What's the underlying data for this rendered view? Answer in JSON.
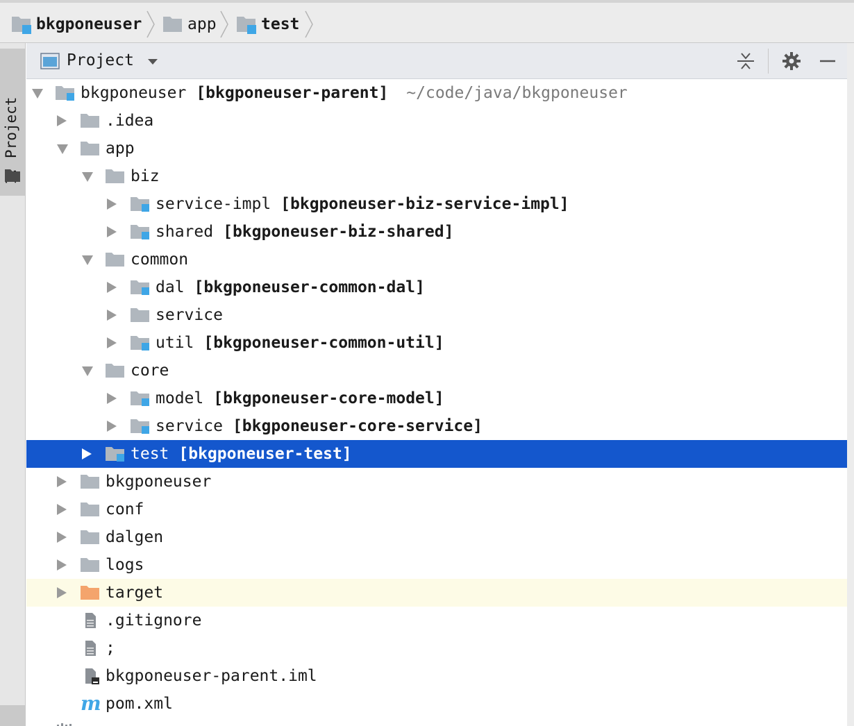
{
  "breadcrumb": {
    "items": [
      {
        "label": "bkgponeuser",
        "bold": true
      },
      {
        "label": "app",
        "bold": false
      },
      {
        "label": "test",
        "bold": true
      }
    ]
  },
  "sidebar": {
    "tab_label": "1: Project"
  },
  "toolbar": {
    "title": "Project"
  },
  "tree": {
    "rows": [
      {
        "label": "bkgponeuser",
        "module": "[bkgponeuser-parent]",
        "path": "~/code/java/bkgponeuser"
      },
      {
        "label": ".idea"
      },
      {
        "label": "app"
      },
      {
        "label": "biz"
      },
      {
        "label": "service-impl",
        "module": "[bkgponeuser-biz-service-impl]"
      },
      {
        "label": "shared",
        "module": "[bkgponeuser-biz-shared]"
      },
      {
        "label": "common"
      },
      {
        "label": "dal",
        "module": "[bkgponeuser-common-dal]"
      },
      {
        "label": "service"
      },
      {
        "label": "util",
        "module": "[bkgponeuser-common-util]"
      },
      {
        "label": "core"
      },
      {
        "label": "model",
        "module": "[bkgponeuser-core-model]"
      },
      {
        "label": "service",
        "module": "[bkgponeuser-core-service]"
      },
      {
        "label": "test",
        "module": "[bkgponeuser-test]"
      },
      {
        "label": "bkgponeuser"
      },
      {
        "label": "conf"
      },
      {
        "label": "dalgen"
      },
      {
        "label": "logs"
      },
      {
        "label": "target"
      },
      {
        "label": ".gitignore"
      },
      {
        "label": ";"
      },
      {
        "label": "bkgponeuser-parent.iml"
      },
      {
        "label": "pom.xml"
      }
    ]
  },
  "colors": {
    "selection": "#1457cd",
    "folder": "#b0b7be",
    "module_badge": "#3fa6e6",
    "excluded_folder": "#f4a46c",
    "maven": "#3fa6e6"
  }
}
